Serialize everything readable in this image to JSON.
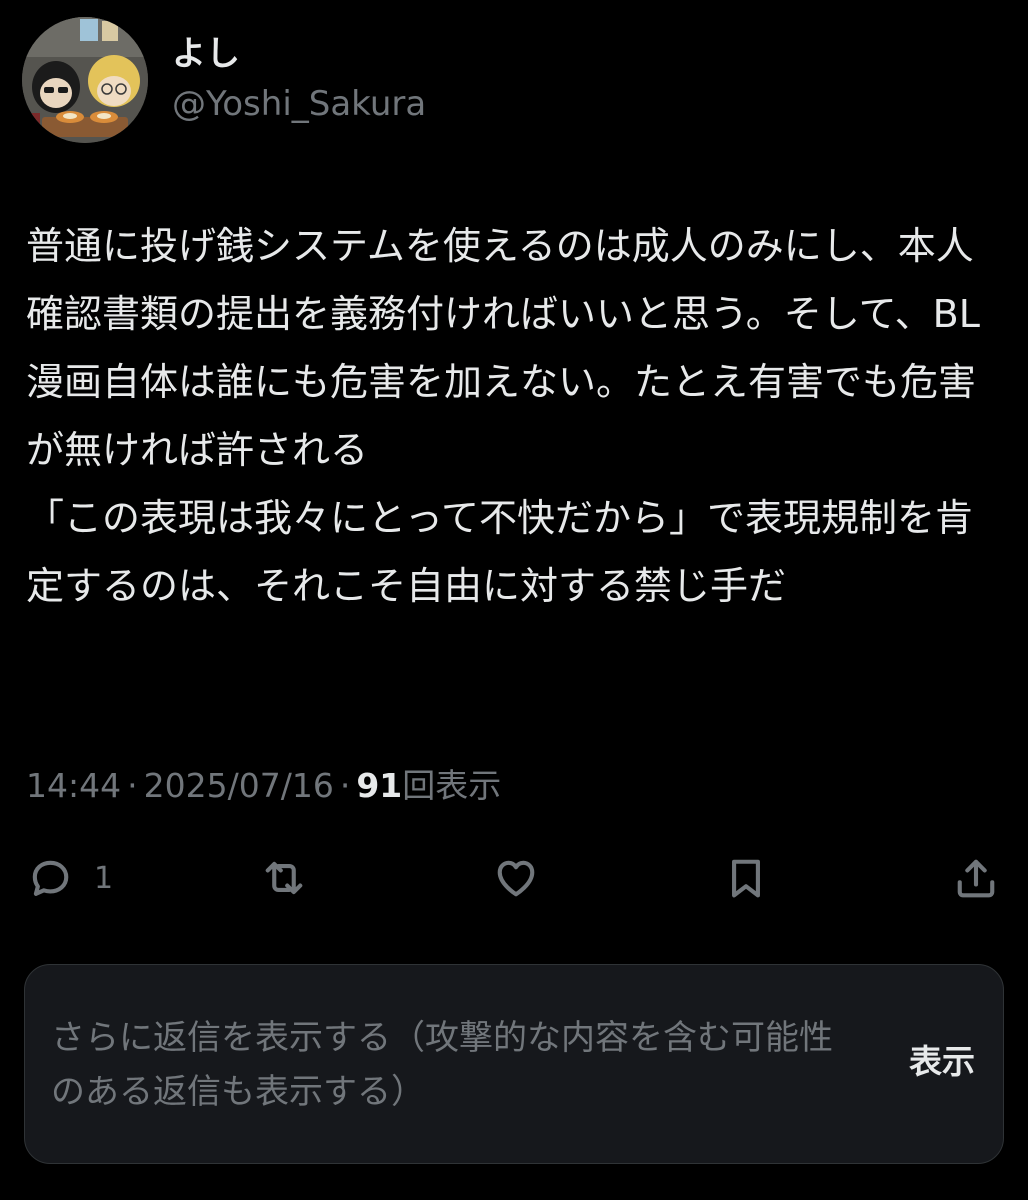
{
  "author": {
    "display_name": "よし",
    "handle": "@Yoshi_Sakura"
  },
  "tweet": {
    "text": "普通に投げ銭システムを使えるのは成人のみにし、本人確認書類の提出を義務付ければいいと思う。そして、BL漫画自体は誰にも危害を加えない。たとえ有害でも危害が無ければ許される\n「この表現は我々にとって不快だから」で表現規制を肯定するのは、それこそ自由に対する禁じ手だ",
    "time": "14:44",
    "separator": "·",
    "date": "2025/07/16",
    "views_count": "91",
    "views_label": "回表示"
  },
  "actions": {
    "reply_count": "1"
  },
  "more_replies": {
    "text": "さらに返信を表示する（攻撃的な内容を含む可能性のある返信も表示する）",
    "button_label": "表示"
  },
  "icons": {
    "reply": "reply-icon",
    "retweet": "retweet-icon",
    "like": "like-icon",
    "bookmark": "bookmark-icon",
    "share": "share-icon"
  },
  "colors": {
    "background": "#000000",
    "text_primary": "#e7e9ea",
    "text_secondary": "#71767b",
    "panel": "#16181c"
  }
}
